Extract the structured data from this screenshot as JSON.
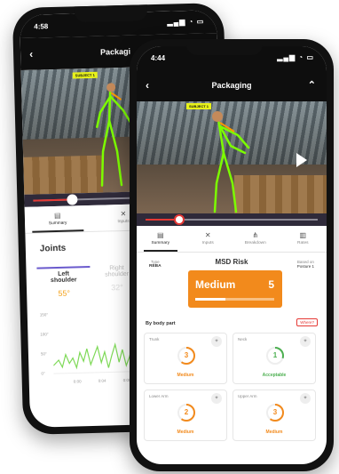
{
  "back_phone": {
    "status": {
      "time": "4:58",
      "icons": "▂▄▆ ◔ ▭"
    },
    "nav": {
      "back": "‹",
      "title": "Packagi"
    },
    "video": {
      "subject_tag": "SUBJECT 1"
    },
    "tabs": [
      {
        "icon": "clipboard-icon",
        "glyph": "▤",
        "label": "Summary"
      },
      {
        "icon": "tools-icon",
        "glyph": "✕",
        "label": "Inputs"
      }
    ],
    "joints": {
      "title": "Joints",
      "items": [
        {
          "label": "Left\nshoulder",
          "value": "55°"
        },
        {
          "label": "Right\nshoulder",
          "value": "32°"
        }
      ],
      "y_ticks": [
        "150°",
        "100°",
        "50°",
        "0°"
      ],
      "x_ticks": [
        "0:00",
        "0:04",
        "0:08"
      ]
    }
  },
  "front_phone": {
    "status": {
      "time": "4:44",
      "icons": "▂▄▆ ◔ ▭"
    },
    "nav": {
      "back": "‹",
      "title": "Packaging",
      "collapse": "⌃"
    },
    "video": {
      "subject_tag": "SUBJECT 1"
    },
    "tabs": [
      {
        "icon": "clipboard-icon",
        "glyph": "▤",
        "label": "Summary"
      },
      {
        "icon": "tools-icon",
        "glyph": "✕",
        "label": "Inputs"
      },
      {
        "icon": "hierarchy-icon",
        "glyph": "⋔",
        "label": "Breakdown"
      },
      {
        "icon": "chart-icon",
        "glyph": "▥",
        "label": "Rates"
      }
    ],
    "msd": {
      "title": "MSD Risk",
      "type_label": "Type",
      "type_value": "REBA",
      "based_label": "Based on",
      "based_value": "Posture 1",
      "level": "Medium",
      "score": "5",
      "score_fill": 0.38,
      "accent": "#f28a1c"
    },
    "body_part": {
      "title": "By body part",
      "where_label": "Where?",
      "cards": [
        {
          "name": "Trunk",
          "score": "3",
          "level": "Medium",
          "color": "#f28a1c",
          "fill": 0.6
        },
        {
          "name": "Neck",
          "score": "1",
          "level": "Acceptable",
          "color": "#4caf50",
          "fill": 0.3
        },
        {
          "name": "Lower Arm",
          "score": "2",
          "level": "Medium",
          "color": "#f28a1c",
          "fill": 0.6
        },
        {
          "name": "Upper Arm",
          "score": "3",
          "level": "Medium",
          "color": "#f28a1c",
          "fill": 0.6
        }
      ]
    }
  }
}
